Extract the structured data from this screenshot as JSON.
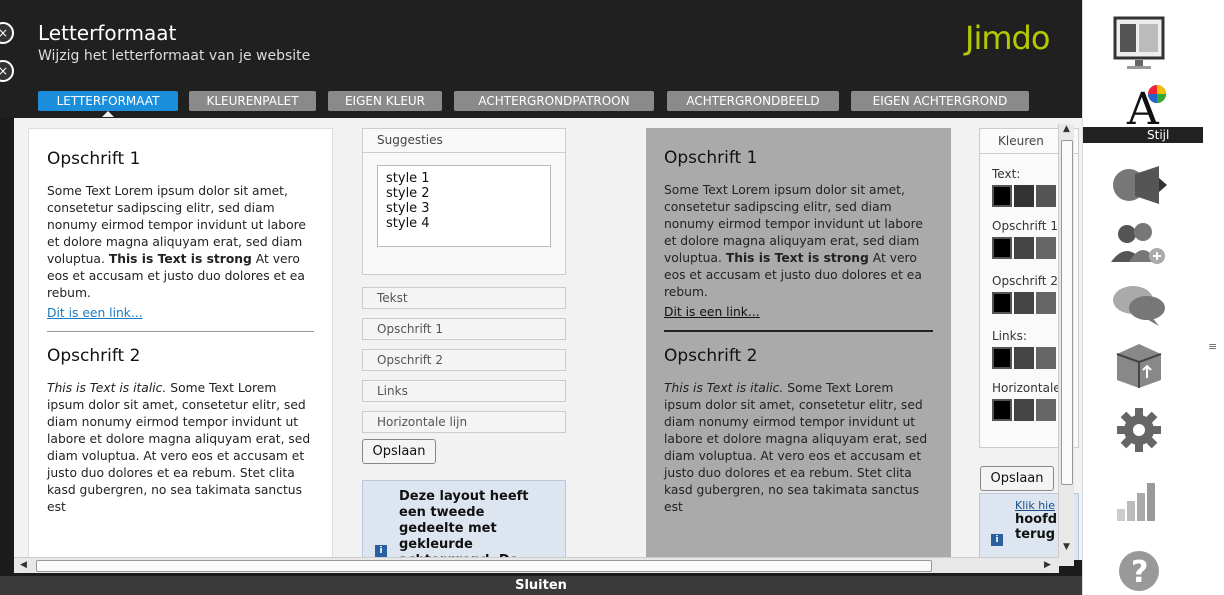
{
  "header": {
    "title": "Letterformaat",
    "subtitle": "Wijzig het letterformaat van je website",
    "logo": "Jimdo"
  },
  "tabs": [
    {
      "label": "LETTERFORMAAT",
      "active": true
    },
    {
      "label": "KLEURENPALET",
      "active": false
    },
    {
      "label": "EIGEN KLEUR",
      "active": false
    },
    {
      "label": "ACHTERGRONDPATROON",
      "active": false
    },
    {
      "label": "ACHTERGRONDBEELD",
      "active": false
    },
    {
      "label": "EIGEN ACHTERGROND",
      "active": false
    }
  ],
  "preview": {
    "heading1": "Opschrift 1",
    "para1_text": "Some Text Lorem ipsum dolor sit amet, consetetur sadipscing elitr, sed diam nonumy eirmod tempor invidunt ut labore et dolore magna aliquyam erat, sed diam voluptua.",
    "para1_strong": "This is Text is strong",
    "para1_tail": "At vero eos et accusam et justo duo dolores et ea rebum.",
    "link": "Dit is een link...",
    "heading2": "Opschrift 2",
    "para2_italic": "This is Text is italic.",
    "para2_text": "Some Text Lorem ipsum dolor sit amet, consetetur elitr, sed diam nonumy eirmod tempor invidunt ut labore et dolore magna aliquyam erat, sed diam voluptua. At vero eos et accusam et justo duo dolores et ea rebum. Stet clita kasd gubergren, no sea takimata sanctus est"
  },
  "suggestions": {
    "header": "Suggesties",
    "items": [
      "style 1",
      "style 2",
      "style 3",
      "style 4"
    ]
  },
  "element_buttons": [
    "Tekst",
    "Opschrift 1",
    "Opschrift 2",
    "Links",
    "Horizontale lijn"
  ],
  "save_label": "Opslaan",
  "info_message": "Deze layout heeft een tweede gedeelte met gekleurde achtergrond. De",
  "colors_panel": {
    "header": "Kleuren",
    "groups": [
      {
        "label": "Text:",
        "swatches": [
          "#000000",
          "#333333",
          "#555555"
        ]
      },
      {
        "label": "Opschrift 1",
        "swatches": [
          "#000000",
          "#444444",
          "#666666"
        ]
      },
      {
        "label": "Opschrift 2",
        "swatches": [
          "#000000",
          "#444444",
          "#666666"
        ]
      },
      {
        "label": "Links:",
        "swatches": [
          "#000000",
          "#444444",
          "#666666"
        ]
      },
      {
        "label": "Horizontale",
        "swatches": [
          "#000000",
          "#444444",
          "#666666"
        ]
      }
    ],
    "info_link": "Klik hie",
    "info_bold1": "hoofdi",
    "info_bold2": "terug"
  },
  "footer": {
    "close_label": "Sluiten"
  },
  "toolbar": {
    "active_label": "Stijl"
  },
  "theme": {
    "accent": "#1a8ddb",
    "logo_color": "#b5c900",
    "panel_bg": "#1b1b1b",
    "preview_grey": "#aaaaaa"
  }
}
